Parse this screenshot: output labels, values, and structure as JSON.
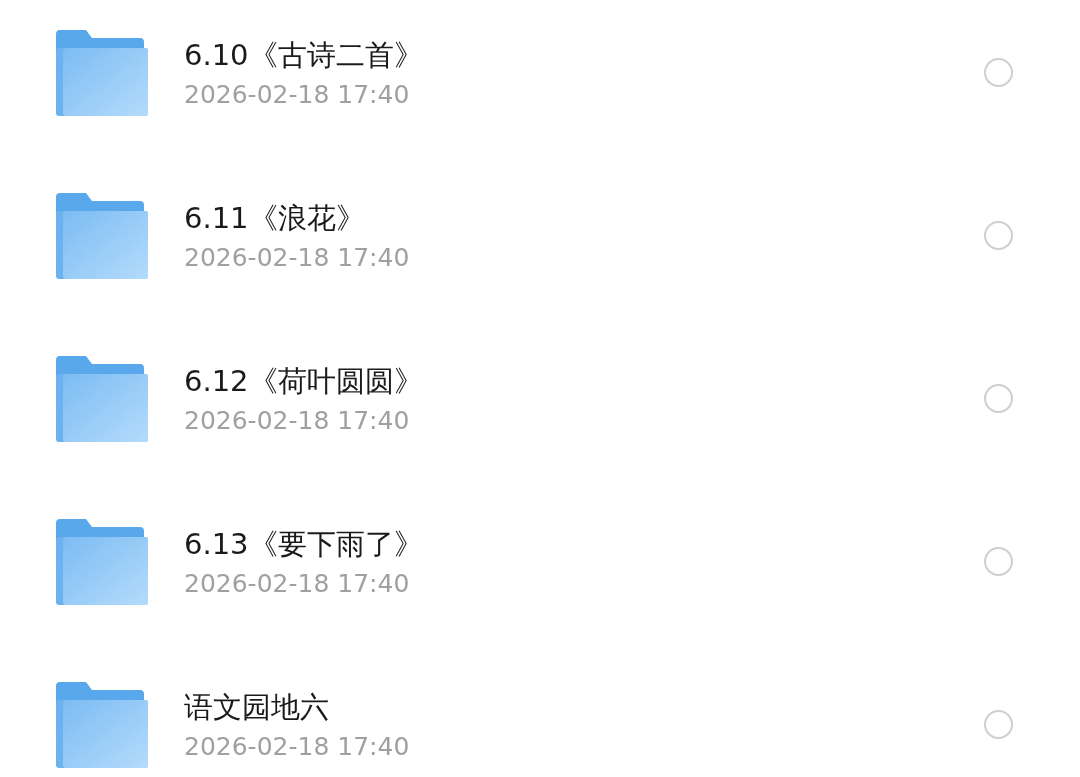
{
  "folders": [
    {
      "name": "6.10《古诗二首》",
      "date": "2026-02-18 17:40",
      "selected": false
    },
    {
      "name": "6.11《浪花》",
      "date": "2026-02-18 17:40",
      "selected": false
    },
    {
      "name": "6.12《荷叶圆圆》",
      "date": "2026-02-18 17:40",
      "selected": false
    },
    {
      "name": "6.13《要下雨了》",
      "date": "2026-02-18 17:40",
      "selected": false
    },
    {
      "name": "语文园地六",
      "date": "2026-02-18 17:40",
      "selected": false
    }
  ]
}
